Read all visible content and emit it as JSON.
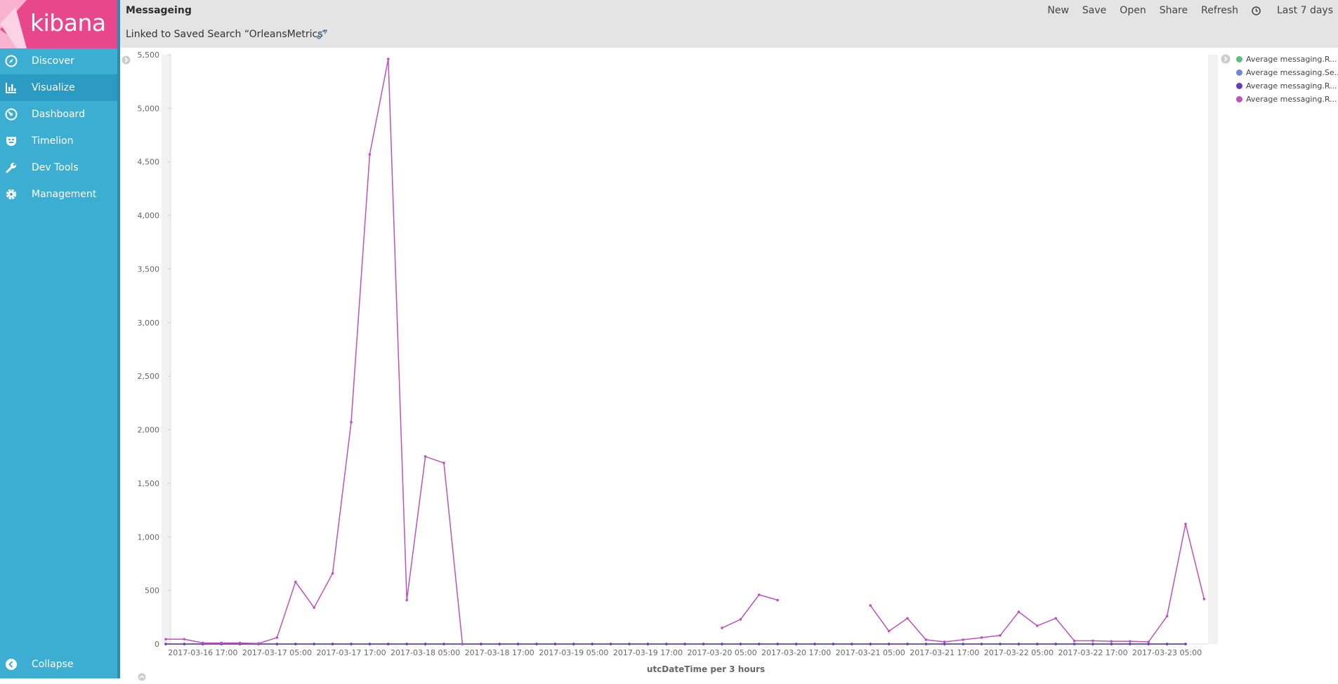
{
  "app": {
    "logo_text": "kibana",
    "brand_color": "#e8488b",
    "sidebar_color": "#3caed2"
  },
  "sidebar": {
    "items": [
      {
        "label": "Discover",
        "icon": "compass-icon"
      },
      {
        "label": "Visualize",
        "icon": "bar-chart-icon",
        "active": true
      },
      {
        "label": "Dashboard",
        "icon": "dashboard-gauge-icon"
      },
      {
        "label": "Timelion",
        "icon": "timelion-mask-icon"
      },
      {
        "label": "Dev Tools",
        "icon": "wrench-icon"
      },
      {
        "label": "Management",
        "icon": "gear-icon"
      }
    ],
    "collapse_label": "Collapse"
  },
  "header": {
    "title": "Messageing",
    "linked_search": "Linked to Saved Search “OrleansMetrics”",
    "menu": {
      "new": "New",
      "save": "Save",
      "open": "Open",
      "share": "Share",
      "refresh": "Refresh",
      "timepicker": "Last 7 days"
    }
  },
  "legend": {
    "items": [
      {
        "label": "Average messaging.R...",
        "color": "#57c17b"
      },
      {
        "label": "Average messaging.Se...",
        "color": "#6f87d8"
      },
      {
        "label": "Average messaging.R...",
        "color": "#663db8"
      },
      {
        "label": "Average messaging.R...",
        "color": "#bc52bc"
      }
    ]
  },
  "chart_data": {
    "type": "line",
    "xlabel": "utcDateTime per 3 hours",
    "ylabel": "",
    "ylim": [
      0,
      5500
    ],
    "yticks": [
      0,
      500,
      1000,
      1500,
      2000,
      2500,
      3000,
      3500,
      4000,
      4500,
      5000,
      5500
    ],
    "ytick_labels": [
      "0",
      "500",
      "1,000",
      "1,500",
      "2,000",
      "2,500",
      "3,000",
      "3,500",
      "4,000",
      "4,500",
      "5,000",
      "5,500"
    ],
    "x_ticks": [
      {
        "label": "2017-03-16 17:00",
        "index": 2
      },
      {
        "label": "2017-03-17 05:00",
        "index": 6
      },
      {
        "label": "2017-03-17 17:00",
        "index": 10
      },
      {
        "label": "2017-03-18 05:00",
        "index": 14
      },
      {
        "label": "2017-03-18 17:00",
        "index": 18
      },
      {
        "label": "2017-03-19 05:00",
        "index": 22
      },
      {
        "label": "2017-03-19 17:00",
        "index": 26
      },
      {
        "label": "2017-03-20 05:00",
        "index": 30
      },
      {
        "label": "2017-03-20 17:00",
        "index": 34
      },
      {
        "label": "2017-03-21 05:00",
        "index": 38
      },
      {
        "label": "2017-03-21 17:00",
        "index": 42
      },
      {
        "label": "2017-03-22 05:00",
        "index": 46
      },
      {
        "label": "2017-03-22 17:00",
        "index": 50
      },
      {
        "label": "2017-03-23 05:00",
        "index": 54
      }
    ],
    "n_points": 56,
    "series": [
      {
        "color": "#57c17b",
        "values": [
          0,
          0,
          0,
          0,
          0,
          0,
          0,
          0,
          0,
          0,
          0,
          0,
          0,
          0,
          0,
          0,
          0,
          0,
          0,
          0,
          0,
          0,
          0,
          0,
          0,
          0,
          0,
          0,
          0,
          0,
          0,
          0,
          0,
          0,
          0,
          0,
          0,
          0,
          0,
          0,
          0,
          0,
          0,
          0,
          0,
          0,
          0,
          0,
          0,
          0,
          0,
          0,
          0,
          0,
          0,
          0
        ]
      },
      {
        "color": "#6f87d8",
        "values": [
          0,
          0,
          0,
          0,
          0,
          0,
          0,
          0,
          0,
          0,
          0,
          0,
          0,
          0,
          0,
          0,
          0,
          0,
          0,
          0,
          0,
          0,
          0,
          0,
          0,
          0,
          0,
          0,
          0,
          0,
          0,
          0,
          0,
          0,
          0,
          0,
          0,
          0,
          0,
          0,
          0,
          0,
          0,
          0,
          0,
          0,
          0,
          0,
          0,
          0,
          0,
          0,
          0,
          0,
          0,
          0
        ]
      },
      {
        "color": "#663db8",
        "values": [
          0,
          0,
          0,
          0,
          0,
          0,
          0,
          0,
          0,
          0,
          0,
          0,
          0,
          0,
          0,
          0,
          0,
          0,
          0,
          0,
          0,
          0,
          0,
          0,
          0,
          0,
          0,
          0,
          0,
          0,
          0,
          0,
          0,
          0,
          0,
          0,
          0,
          0,
          0,
          0,
          0,
          0,
          0,
          0,
          0,
          0,
          0,
          0,
          0,
          0,
          0,
          0,
          0,
          0,
          0,
          0
        ]
      },
      {
        "color": "#bc52bc",
        "values": [
          45,
          45,
          10,
          10,
          10,
          5,
          60,
          580,
          340,
          660,
          2070,
          4570,
          5460,
          410,
          1750,
          1690,
          0,
          null,
          null,
          null,
          null,
          null,
          null,
          null,
          null,
          null,
          null,
          null,
          null,
          null,
          150,
          230,
          460,
          410,
          null,
          null,
          null,
          null,
          360,
          120,
          240,
          40,
          20,
          40,
          60,
          80,
          300,
          170,
          240,
          30,
          30,
          25,
          25,
          20,
          260,
          1120,
          420
        ]
      }
    ]
  }
}
